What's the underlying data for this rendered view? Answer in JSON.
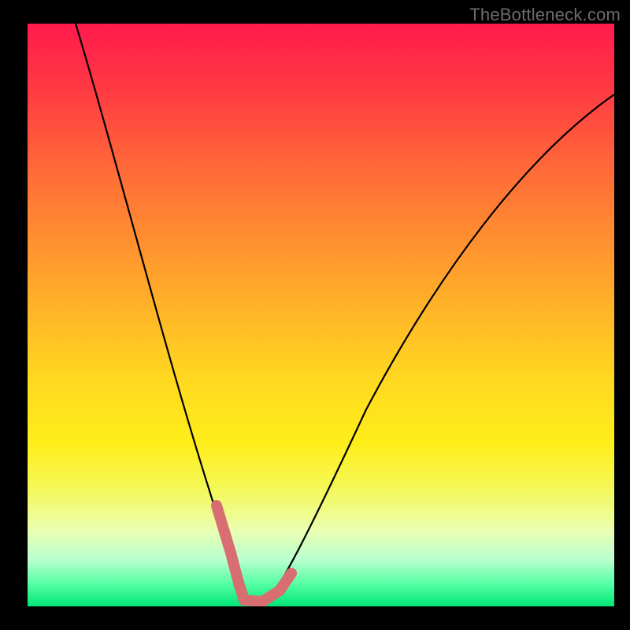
{
  "watermark": "TheBottleneck.com",
  "colors": {
    "background": "#000000",
    "curve": "#000000",
    "marker": "#d86d72",
    "gradient_top": "#ff1a4d",
    "gradient_bottom": "#00e676"
  },
  "chart_data": {
    "type": "line",
    "title": "",
    "xlabel": "",
    "ylabel": "",
    "xlim": [
      0,
      100
    ],
    "ylim": [
      0,
      100
    ],
    "grid": false,
    "legend": false,
    "series": [
      {
        "name": "bottleneck-curve",
        "x": [
          0,
          4,
          8,
          12,
          16,
          20,
          24,
          28,
          30,
          32,
          34,
          36,
          38,
          40,
          44,
          50,
          56,
          62,
          68,
          74,
          80,
          86,
          92,
          100
        ],
        "y": [
          100,
          89,
          78,
          67,
          57,
          47,
          37,
          27,
          22,
          15,
          7,
          2,
          0,
          2,
          7,
          15,
          24,
          33,
          42,
          50,
          58,
          65,
          72,
          80
        ]
      }
    ],
    "markers": {
      "name": "highlight-region",
      "x": [
        30,
        31,
        32,
        33,
        34,
        35,
        36,
        37,
        38,
        39,
        40,
        41,
        42
      ],
      "y": [
        22,
        17,
        12,
        8,
        5,
        3,
        1,
        0,
        0,
        1,
        2,
        4,
        6
      ]
    }
  }
}
